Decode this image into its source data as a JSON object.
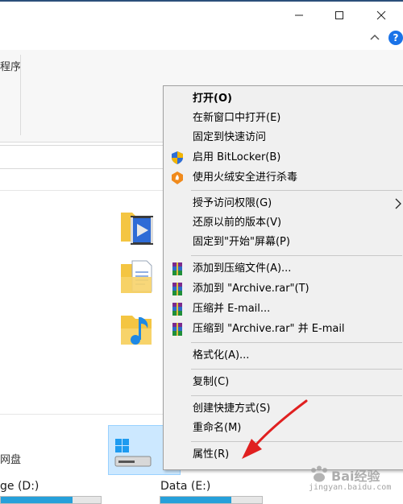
{
  "window": {
    "ribbon_partial_text": "程序"
  },
  "content": {
    "network_drive_partial": "网盘",
    "drives": [
      {
        "label": "ge (D:)",
        "usage": 0.72
      },
      {
        "label": "Data (E:)",
        "usage": 0.7
      }
    ]
  },
  "context_menu": {
    "items": [
      {
        "label": "打开(O)"
      },
      {
        "label": "在新窗口中打开(E)"
      },
      {
        "label": "固定到快速访问"
      },
      {
        "label": "启用 BitLocker(B)",
        "icon": "shield-icon"
      },
      {
        "label": "使用火绒安全进行杀毒",
        "icon": "huorong-icon"
      },
      {
        "label": "授予访问权限(G)",
        "has_submenu": true
      },
      {
        "label": "还原以前的版本(V)"
      },
      {
        "label": "固定到\"开始\"屏幕(P)"
      },
      {
        "label": "添加到压缩文件(A)...",
        "icon": "winrar-icon"
      },
      {
        "label": "添加到 \"Archive.rar\"(T)",
        "icon": "winrar-icon"
      },
      {
        "label": "压缩并 E-mail...",
        "icon": "winrar-icon"
      },
      {
        "label": "压缩到 \"Archive.rar\" 并 E-mail",
        "icon": "winrar-icon"
      },
      {
        "label": "格式化(A)..."
      },
      {
        "label": "复制(C)"
      },
      {
        "label": "创建快捷方式(S)"
      },
      {
        "label": "重命名(M)"
      },
      {
        "label": "属性(R)"
      }
    ]
  },
  "watermark": {
    "text": "Bai经验",
    "sub": "jingyan.baidu.com"
  },
  "colors": {
    "accent": "#1a73e8",
    "selection": "#cce8ff",
    "drive_fill": "#26a0da",
    "annotation_arrow": "#e02020"
  }
}
